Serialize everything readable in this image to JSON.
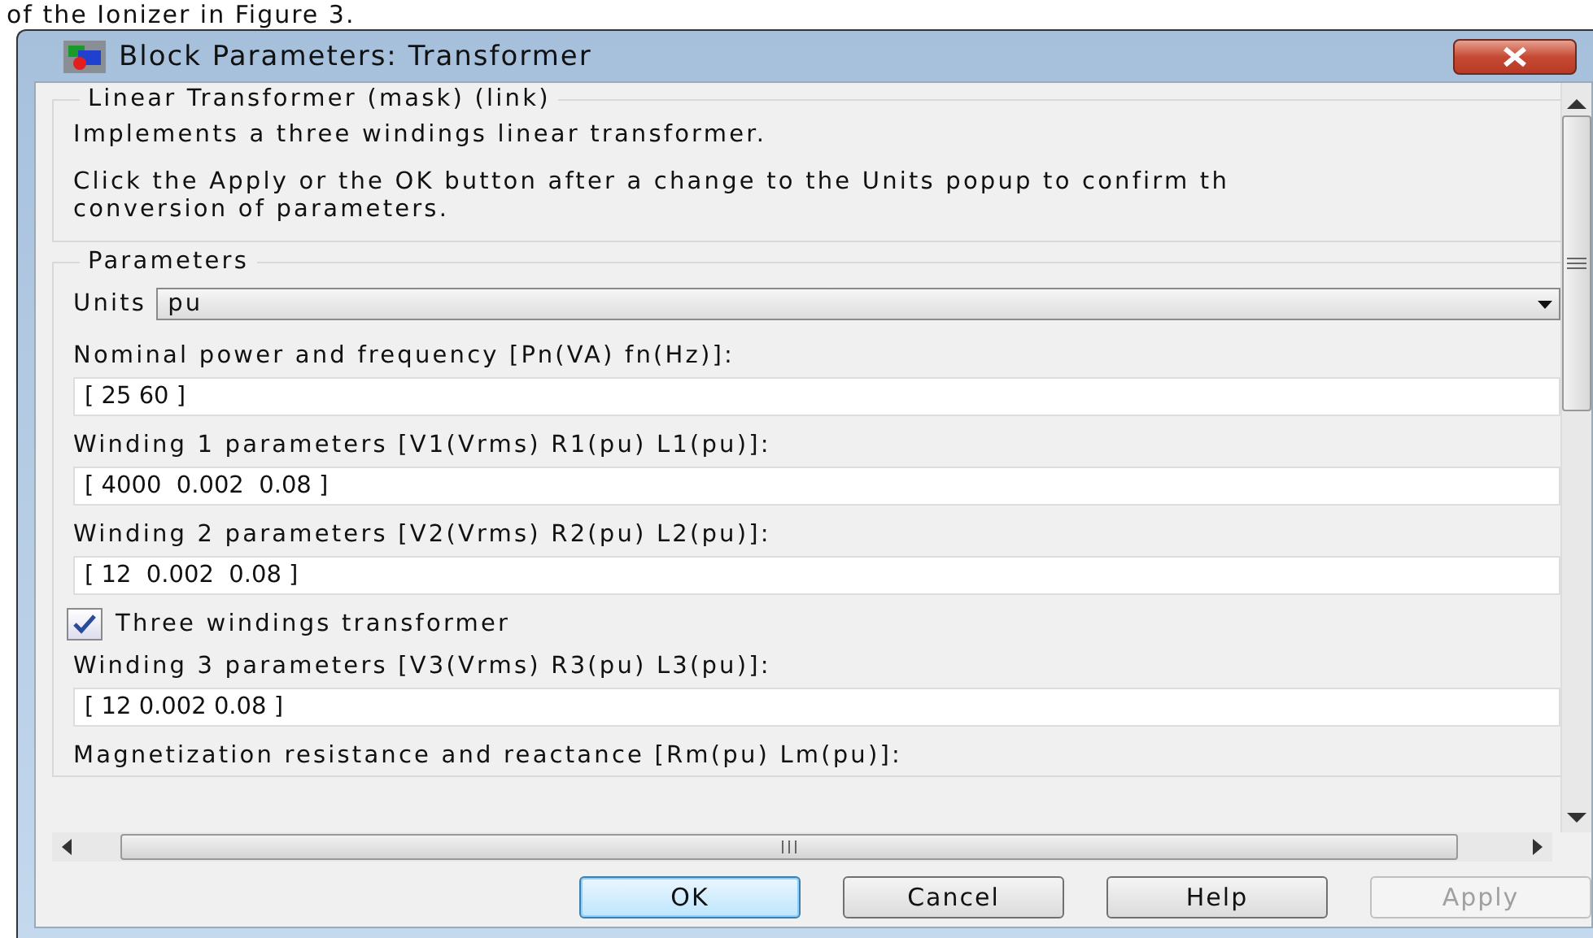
{
  "page_caption": "of the Ionizer in Figure 3.",
  "window": {
    "title": "Block Parameters: Transformer"
  },
  "description": {
    "title": "Linear Transformer (mask) (link)",
    "paragraphs": [
      "Implements a three windings linear transformer.",
      "Click the Apply or the OK button after a change to the Units popup to confirm th\nconversion of parameters."
    ]
  },
  "parameters": {
    "title": "Parameters",
    "items": [
      {
        "kind": "dropdown",
        "label": "Units",
        "value": "pu"
      },
      {
        "kind": "field",
        "label": "Nominal power and frequency [Pn(VA) fn(Hz)]:",
        "value": "[ 25 60 ]"
      },
      {
        "kind": "field",
        "label": "Winding 1 parameters [V1(Vrms) R1(pu) L1(pu)]:",
        "value": "[ 4000  0.002  0.08 ]"
      },
      {
        "kind": "field",
        "label": "Winding 2 parameters [V2(Vrms) R2(pu) L2(pu)]:",
        "value": "[ 12  0.002  0.08 ]"
      },
      {
        "kind": "checkbox",
        "label": "Three windings transformer",
        "checked": true
      },
      {
        "kind": "field",
        "label": "Winding 3 parameters [V3(Vrms) R3(pu) L3(pu)]:",
        "value": "[ 12 0.002 0.08 ]"
      },
      {
        "kind": "label",
        "label": "Magnetization resistance and reactance [Rm(pu) Lm(pu)]:"
      }
    ]
  },
  "buttons": [
    {
      "label": "OK",
      "disabled": false,
      "default": true
    },
    {
      "label": "Cancel",
      "disabled": false,
      "default": false
    },
    {
      "label": "Help",
      "disabled": false,
      "default": false
    },
    {
      "label": "Apply",
      "disabled": true,
      "default": false
    }
  ]
}
